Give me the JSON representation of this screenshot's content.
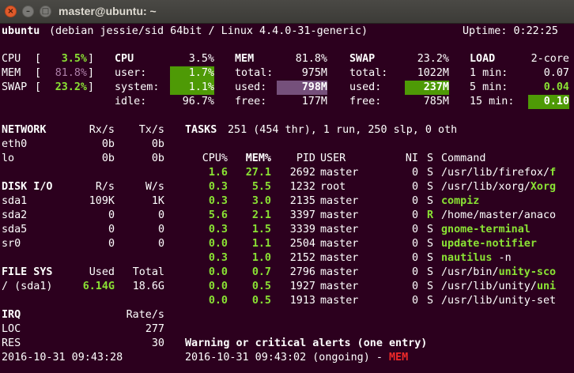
{
  "window": {
    "title": "master@ubuntu: ~",
    "close_glyph": "×",
    "minimize_glyph": "–",
    "maximize_glyph": "□"
  },
  "header": {
    "hostname": "ubuntu",
    "system": "(debian jessie/sid 64bit / Linux 4.4.0-31-generic)",
    "uptime": "Uptime: 0:22:25"
  },
  "quicklook": {
    "cpu_label": "CPU",
    "cpu_value": "3.5%",
    "mem_label": "MEM",
    "mem_value": "81.8%",
    "swap_label": "SWAP",
    "swap_value": "23.2%"
  },
  "cpu": {
    "title": "CPU",
    "total": "3.5%",
    "user_label": "user:",
    "user": "1.7%",
    "system_label": "system:",
    "system": "1.1%",
    "idle_label": "idle:",
    "idle": "96.7%"
  },
  "mem": {
    "title": "MEM",
    "percent": "81.8%",
    "total_label": "total:",
    "total": "975M",
    "used_label": "used:",
    "used": "798M",
    "free_label": "free:",
    "free": "177M"
  },
  "swap": {
    "title": "SWAP",
    "percent": "23.2%",
    "total_label": "total:",
    "total": "1022M",
    "used_label": "used:",
    "used": "237M",
    "free_label": "free:",
    "free": "785M"
  },
  "load": {
    "title": "LOAD",
    "cores": "2-core",
    "min1_label": "1 min:",
    "min1": "0.07",
    "min5_label": "5 min:",
    "min5": "0.04",
    "min15_label": "15 min:",
    "min15": "0.10"
  },
  "network": {
    "title": "NETWORK",
    "rx_header": "Rx/s",
    "tx_header": "Tx/s",
    "rows": [
      {
        "iface": "eth0",
        "rx": "0b",
        "tx": "0b"
      },
      {
        "iface": "lo",
        "rx": "0b",
        "tx": "0b"
      }
    ]
  },
  "diskio": {
    "title": "DISK I/O",
    "r_header": "R/s",
    "w_header": "W/s",
    "rows": [
      {
        "disk": "sda1",
        "r": "109K",
        "w": "1K"
      },
      {
        "disk": "sda2",
        "r": "0",
        "w": "0"
      },
      {
        "disk": "sda5",
        "r": "0",
        "w": "0"
      },
      {
        "disk": "sr0",
        "r": "0",
        "w": "0"
      }
    ]
  },
  "filesys": {
    "title": "FILE SYS",
    "used_header": "Used",
    "total_header": "Total",
    "rows": [
      {
        "mount": "/ (sda1)",
        "used": "6.14G",
        "total": "18.6G"
      }
    ]
  },
  "irq": {
    "title": "IRQ",
    "rate_header": "Rate/s",
    "rows": [
      {
        "name": "LOC",
        "rate": "277"
      },
      {
        "name": "RES",
        "rate": "30"
      }
    ]
  },
  "tasks": {
    "label": "TASKS",
    "summary": "251 (454 thr), 1 run, 250 slp, 0 oth"
  },
  "process_table": {
    "headers": {
      "cpu": "CPU%",
      "mem": "MEM%",
      "pid": "PID",
      "user": "USER",
      "ni": "NI",
      "s": "S",
      "command": "Command"
    },
    "rows": [
      {
        "cpu": "1.6",
        "mem": "27.1",
        "pid": "2692",
        "user": "master",
        "ni": "0",
        "s": "S",
        "cmd_prefix": "/usr/lib/firefox/",
        "cmd_hl": "f"
      },
      {
        "cpu": "0.3",
        "mem": "5.5",
        "pid": "1232",
        "user": "root",
        "ni": "0",
        "s": "S",
        "cmd_prefix": "/usr/lib/xorg/",
        "cmd_hl": "Xorg"
      },
      {
        "cpu": "0.3",
        "mem": "3.0",
        "pid": "2135",
        "user": "master",
        "ni": "0",
        "s": "S",
        "cmd_prefix": "",
        "cmd_hl": "compiz"
      },
      {
        "cpu": "5.6",
        "mem": "2.1",
        "pid": "3397",
        "user": "master",
        "ni": "0",
        "s": "R",
        "cmd_prefix": "/home/master/anaco",
        "cmd_hl": ""
      },
      {
        "cpu": "0.3",
        "mem": "1.5",
        "pid": "3339",
        "user": "master",
        "ni": "0",
        "s": "S",
        "cmd_prefix": "",
        "cmd_hl": "gnome-terminal"
      },
      {
        "cpu": "0.0",
        "mem": "1.1",
        "pid": "2504",
        "user": "master",
        "ni": "0",
        "s": "S",
        "cmd_prefix": "",
        "cmd_hl": "update-notifier"
      },
      {
        "cpu": "0.3",
        "mem": "1.0",
        "pid": "2152",
        "user": "master",
        "ni": "0",
        "s": "S",
        "cmd_prefix": "",
        "cmd_hl": "nautilus",
        "cmd_suffix": " -n"
      },
      {
        "cpu": "0.0",
        "mem": "0.7",
        "pid": "2796",
        "user": "master",
        "ni": "0",
        "s": "S",
        "cmd_prefix": "/usr/bin/",
        "cmd_hl": "unity-sco"
      },
      {
        "cpu": "0.0",
        "mem": "0.5",
        "pid": "1927",
        "user": "master",
        "ni": "0",
        "s": "S",
        "cmd_prefix": "/usr/lib/unity/",
        "cmd_hl": "uni"
      },
      {
        "cpu": "0.0",
        "mem": "0.5",
        "pid": "1913",
        "user": "master",
        "ni": "0",
        "s": "S",
        "cmd_prefix": "/usr/lib/unity-set",
        "cmd_hl": ""
      }
    ]
  },
  "alerts": {
    "title": "Warning or critical alerts (one entry)",
    "entry_text": "2016-10-31 09:43:02 (ongoing) - ",
    "entry_type": "MEM"
  },
  "footer": {
    "datetime": "2016-10-31 09:43:28"
  }
}
